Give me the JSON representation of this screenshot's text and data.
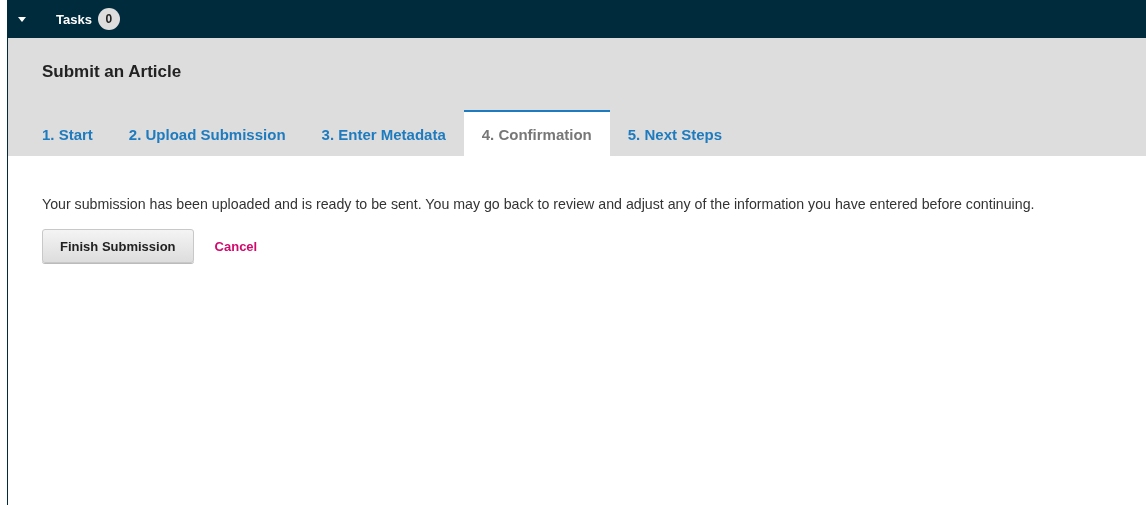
{
  "top_bar": {
    "tasks_label": "Tasks",
    "tasks_count": "0"
  },
  "page_title": "Submit an Article",
  "tabs": [
    {
      "label": "1. Start",
      "selected": false
    },
    {
      "label": "2. Upload Submission",
      "selected": false
    },
    {
      "label": "3. Enter Metadata",
      "selected": false
    },
    {
      "label": "4. Confirmation",
      "selected": true
    },
    {
      "label": "5. Next Steps",
      "selected": false
    }
  ],
  "message": "Your submission has been uploaded and is ready to be sent. You may go back to review and adjust any of the information you have entered before continuing.",
  "buttons": {
    "primary": "Finish Submission",
    "cancel": "Cancel"
  }
}
